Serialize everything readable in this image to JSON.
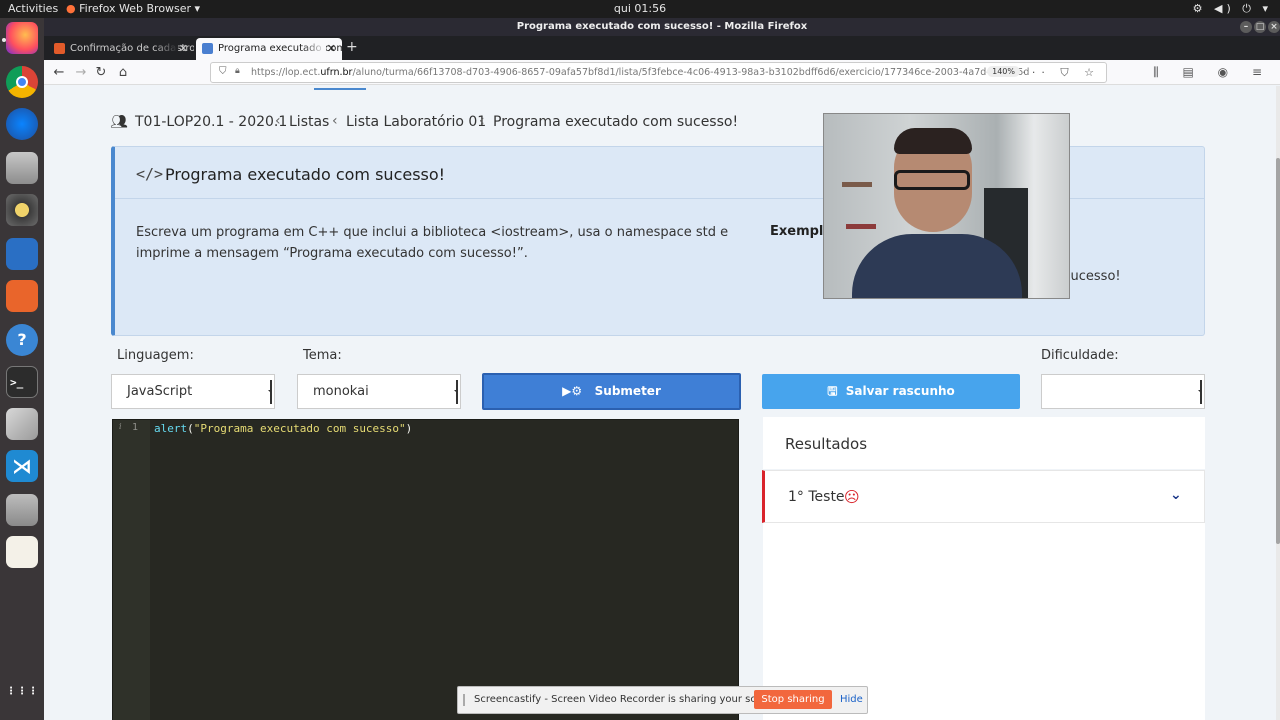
{
  "topbar": {
    "activities": "Activities",
    "app_menu": "Firefox Web Browser ▾",
    "clock": "qui 01:56",
    "tray": "⚙ ◀) ⏻ ▾"
  },
  "dock": {
    "items": [
      "firefox-icon",
      "chrome-icon",
      "thunderbird-icon",
      "files-icon",
      "rhythmbox-icon",
      "writer-icon",
      "software-center-icon",
      "help-icon",
      "terminal-icon",
      "settings-icon",
      "vscode-icon",
      "screenshot-icon",
      "text-editor-icon",
      "app-grid-icon"
    ],
    "help_glyph": "?",
    "terminal_glyph": ">_",
    "vscode_glyph": "⋊",
    "apps_glyph": "⋮⋮⋮"
  },
  "window": {
    "title": "Programa executado com sucesso! - Mozilla Firefox",
    "tabs": [
      {
        "label": "Confirmação de cadastro",
        "active": false
      },
      {
        "label": "Programa executado com sucesso!",
        "active": true
      }
    ],
    "new_tab": "+",
    "close_tab": "✕"
  },
  "navbar": {
    "back": "←",
    "forward": "→",
    "reload": "↻",
    "home": "⌂",
    "url_prefix": "https://lop.ect.",
    "url_domain": "ufrn.br",
    "url_rest": "/aluno/turma/66f13708-d703-4906-8657-09afa57bf8d1/lista/5f3febce-4c06-4913-98a3-b3102bdff6d6/exercicio/177346ce-2003-4a7d-b324-5d",
    "zoom": "140%",
    "url_icons": "··· ⛉ ☆",
    "right_icons": "⫼ ▤ ◉ ≡"
  },
  "breadcrumb": {
    "course": "T01-LOP20.1 - 2020.1",
    "lists": "Listas",
    "list": "Lista Laboratório 01",
    "current": "Programa executado com sucesso!"
  },
  "exercise": {
    "title": "Programa executado com sucesso!",
    "description": "Escreva um programa em C++ que inclui a biblioteca <iostream>, usa o namespace std e imprime a mensagem “Programa executado com sucesso!”.",
    "example_label": "Exemplo",
    "example_output_visible": "om sucesso!"
  },
  "controls": {
    "language_label": "Linguagem:",
    "language_value": "JavaScript",
    "theme_label": "Tema:",
    "theme_value": "monokai",
    "difficulty_label": "Dificuldade:",
    "difficulty_value": "",
    "submit_label": "Submeter",
    "save_draft_label": "Salvar rascunho"
  },
  "editor": {
    "line_number": "1",
    "gutter_info": "i",
    "code_fn": "alert",
    "code_open": "(",
    "code_string": "\"Programa executado com sucesso\"",
    "code_close": ")"
  },
  "results": {
    "title": "Resultados",
    "tests": [
      {
        "label": "1° Teste",
        "status_icon": "☹",
        "status": "failed"
      }
    ],
    "expand_icon": "⌄"
  },
  "sharing": {
    "message": "Screencastify - Screen Video Recorder is sharing your screen.",
    "stop_label": "Stop sharing",
    "hide_label": "Hide"
  },
  "colors": {
    "submit": "#3f7fd6",
    "draft": "#47a4ed",
    "fail": "#d9232b",
    "editor_bg": "#272822"
  }
}
